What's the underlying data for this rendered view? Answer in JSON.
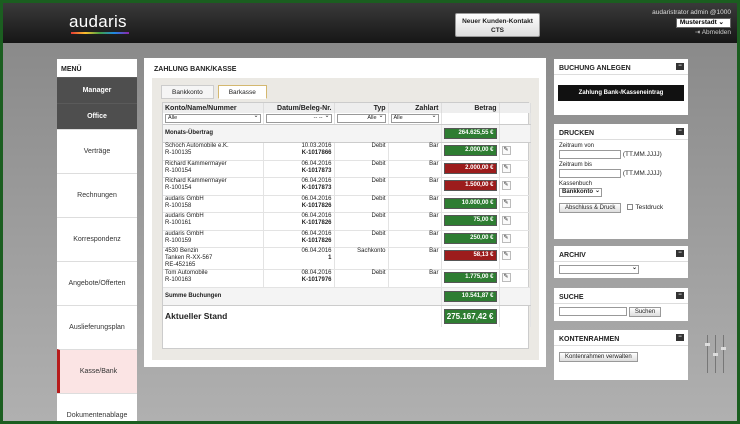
{
  "header": {
    "logo": "audaris",
    "contact_button": "Neuer Kunden-Kontakt\nCTS",
    "user": "audaristrator admin @1000",
    "location": "Musterstadt",
    "logout": "Abmelden"
  },
  "sidebar": {
    "title": "MENÜ",
    "items": [
      "Manager",
      "Office",
      "Verträge",
      "Rechnungen",
      "Korrespondenz",
      "Angebote/Offerten",
      "Auslieferungsplan",
      "Kasse/Bank",
      "Dokumentenablage"
    ]
  },
  "main": {
    "title": "ZAHLUNG BANK/KASSE",
    "tabs": [
      "Bankkonto",
      "Barkasse"
    ],
    "columns": [
      "Konto/Name/Nummer",
      "Datum/Beleg-Nr.",
      "Typ",
      "Zahlart",
      "Betrag"
    ],
    "filters": {
      "konto": "Alle",
      "datum": "-- --",
      "typ": "Alle",
      "zahlart": "Alle"
    },
    "carryover": {
      "label": "Monats-Übertrag",
      "amount": "264.625,55 €"
    },
    "rows": [
      {
        "name": "Schoch Automobile e.K.",
        "nr": "R-100135",
        "extra": "",
        "date": "10.03.2016",
        "beleg": "K-1017866",
        "typ": "Debit",
        "zahlart": "Bar",
        "amount": "2.000,00 €",
        "color": "#2e7d32"
      },
      {
        "name": "Richard Kammermayer",
        "nr": "R-100154",
        "extra": "",
        "date": "06.04.2016",
        "beleg": "K-1017873",
        "typ": "Debit",
        "zahlart": "Bar",
        "amount": "2.000,00 €",
        "color": "#9c1c1c"
      },
      {
        "name": "Richard Kammermayer",
        "nr": "R-100154",
        "extra": "",
        "date": "06.04.2016",
        "beleg": "K-1017873",
        "typ": "Debit",
        "zahlart": "Bar",
        "amount": "1.500,00 €",
        "color": "#9c1c1c"
      },
      {
        "name": "audaris GmbH",
        "nr": "R-100158",
        "extra": "",
        "date": "06.04.2016",
        "beleg": "K-1017826",
        "typ": "Debit",
        "zahlart": "Bar",
        "amount": "10.000,00 €",
        "color": "#2e7d32"
      },
      {
        "name": "audaris GmbH",
        "nr": "R-100161",
        "extra": "",
        "date": "06.04.2016",
        "beleg": "K-1017826",
        "typ": "Debit",
        "zahlart": "Bar",
        "amount": "75,00 €",
        "color": "#2e7d32"
      },
      {
        "name": "audaris GmbH",
        "nr": "R-100159",
        "extra": "",
        "date": "06.04.2016",
        "beleg": "K-1017826",
        "typ": "Debit",
        "zahlart": "Bar",
        "amount": "250,00 €",
        "color": "#2e7d32"
      },
      {
        "name": "4530 Benzin",
        "nr": "Tanken R-XX-567",
        "extra": "RE-452165",
        "date": "06.04.2016",
        "beleg": "1",
        "typ": "Sachkonto",
        "zahlart": "Bar",
        "amount": "58,13 €",
        "color": "#9c1c1c"
      },
      {
        "name": "Tom Automobile",
        "nr": "R-100163",
        "extra": "",
        "date": "08.04.2016",
        "beleg": "K-1017976",
        "typ": "Debit",
        "zahlart": "Bar",
        "amount": "1.775,00 €",
        "color": "#2e7d32"
      }
    ],
    "sum": {
      "label": "Summe Buchungen",
      "amount": "10.541,87 €"
    },
    "total": {
      "label": "Aktueller Stand",
      "amount": "275.167,42 €"
    }
  },
  "right": {
    "buchung": {
      "title": "BUCHUNG ANLEGEN",
      "button": "Zahlung Bank-/Kasseneintrag"
    },
    "drucken": {
      "title": "DRUCKEN",
      "von": "Zeitraum von",
      "bis": "Zeitraum bis",
      "format": "(TT.MM.JJJJ)",
      "kassenbuch": "Kassenbuch",
      "kassenbuch_value": "Bankkonto",
      "button": "Abschluss & Druck",
      "testdruck": "Testdruck"
    },
    "archiv": {
      "title": "ARCHIV"
    },
    "suche": {
      "title": "SUCHE",
      "button": "Suchen"
    },
    "konten": {
      "title": "KONTENRAHMEN",
      "button": "Kontenrahmen verwalten"
    }
  },
  "colors": {
    "accent_green": "#2e7d32",
    "accent_red": "#9c1c1c",
    "active_menu": "#b71c1c"
  }
}
